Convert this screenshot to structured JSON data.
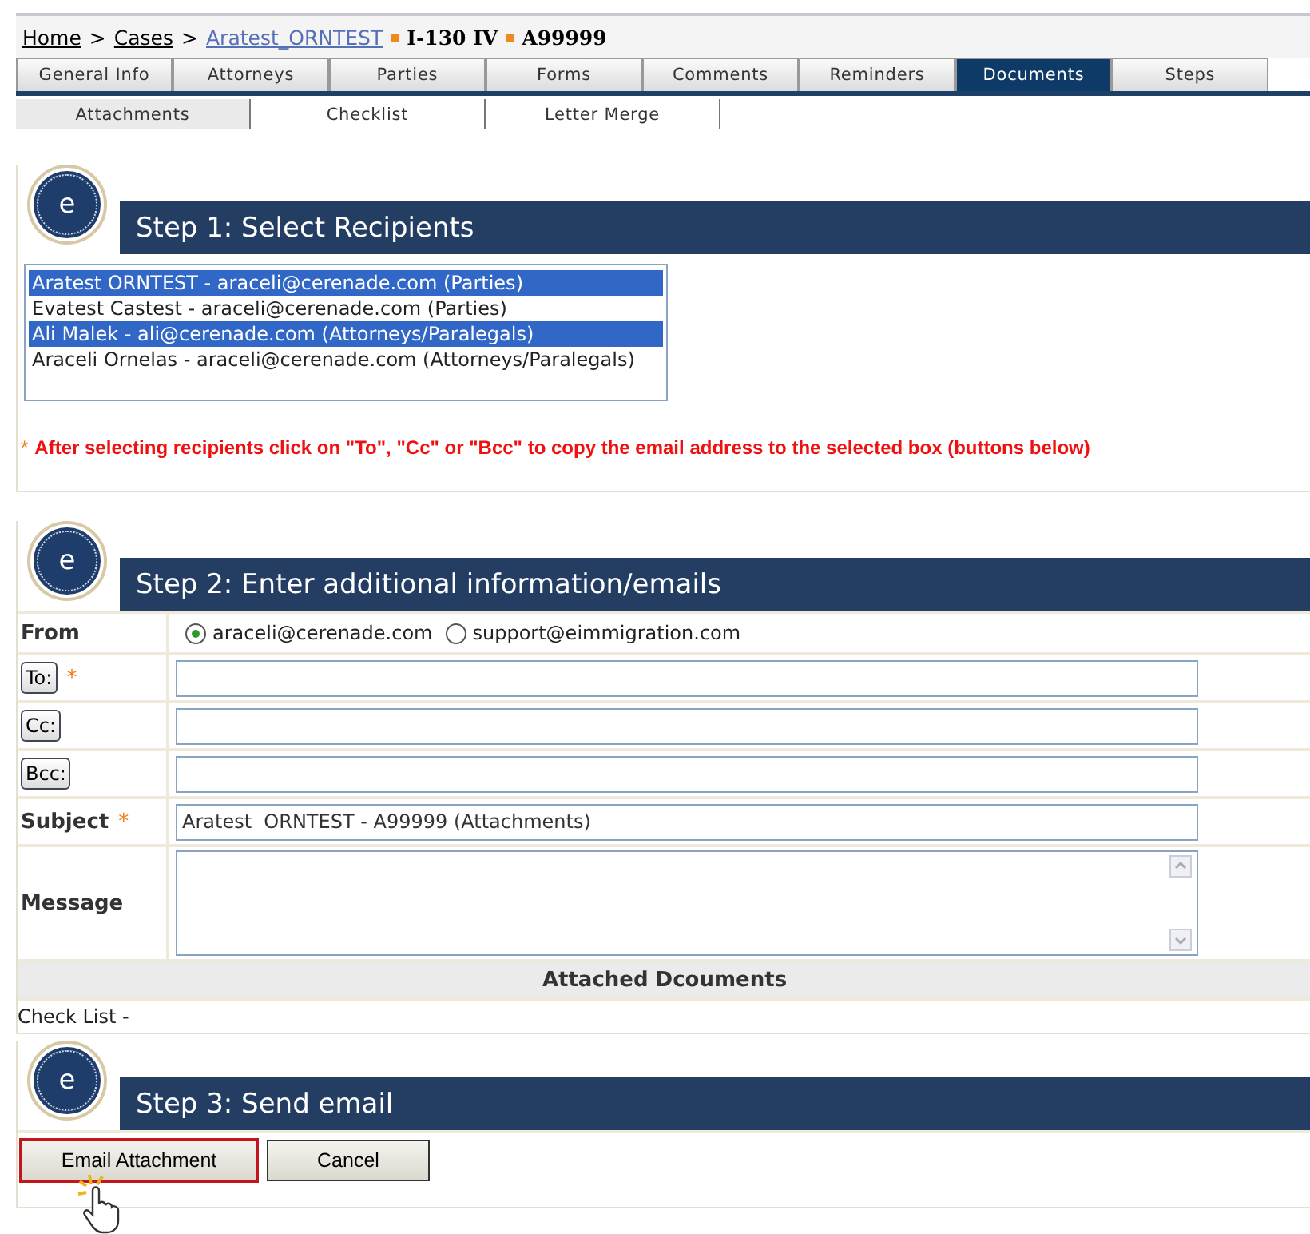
{
  "breadcrumb": [
    {
      "label": "Home",
      "kind": "link"
    },
    {
      "label": ">",
      "kind": "sep"
    },
    {
      "label": "Cases",
      "kind": "link"
    },
    {
      "label": ">",
      "kind": "sep"
    },
    {
      "label": "Aratest_ORNTEST",
      "kind": "case"
    },
    {
      "label": "I-130 IV",
      "kind": "bold"
    },
    {
      "label": "A99999",
      "kind": "bold"
    }
  ],
  "tabs": [
    {
      "label": "General Info",
      "selected": false
    },
    {
      "label": "Attorneys",
      "selected": false
    },
    {
      "label": "Parties",
      "selected": false
    },
    {
      "label": "Forms",
      "selected": false
    },
    {
      "label": "Comments",
      "selected": false
    },
    {
      "label": "Reminders",
      "selected": false
    },
    {
      "label": "Documents",
      "selected": true
    },
    {
      "label": "Steps",
      "selected": false
    }
  ],
  "subtabs": [
    {
      "label": "Attachments",
      "selected": true
    },
    {
      "label": "Checklist",
      "selected": false
    },
    {
      "label": "Letter Merge",
      "selected": false
    }
  ],
  "step1": {
    "badge": "e",
    "title": "Step 1: Select Recipients",
    "recipients": [
      {
        "label": "Aratest ORNTEST - araceli@cerenade.com (Parties)",
        "selected": true
      },
      {
        "label": "Evatest Castest - araceli@cerenade.com (Parties)",
        "selected": false
      },
      {
        "label": "Ali Malek - ali@cerenade.com (Attorneys/Paralegals)",
        "selected": true
      },
      {
        "label": "Araceli Ornelas - araceli@cerenade.com (Attorneys/Paralegals)",
        "selected": false
      }
    ],
    "note_mark": "*",
    "note": "After selecting recipients click on \"To\", \"Cc\" or \"Bcc\" to copy the email address to the selected box (buttons below)"
  },
  "step2": {
    "badge": "e",
    "title": "Step 2: Enter additional information/emails",
    "from": {
      "label": "From",
      "options": [
        {
          "label": "araceli@cerenade.com",
          "selected": true
        },
        {
          "label": "support@eimmigration.com",
          "selected": false
        }
      ]
    },
    "fields": [
      {
        "kind": "button",
        "label": "To:",
        "required": true
      },
      {
        "kind": "button",
        "label": "Cc:",
        "required": false
      },
      {
        "kind": "button",
        "label": "Bcc:",
        "required": false
      },
      {
        "kind": "label",
        "label": "Subject",
        "required": true,
        "value": "Aratest  ORNTEST - A99999 (Attachments)"
      },
      {
        "kind": "textarea",
        "label": "Message",
        "required": false
      }
    ],
    "required_mark": "*",
    "attached_heading": "Attached Dcouments",
    "checklist": "Check List -"
  },
  "step3": {
    "badge": "e",
    "title": "Step 3: Send email",
    "buttons": [
      {
        "label": "Email Attachment",
        "highlighted": true,
        "cursor": true
      },
      {
        "label": "Cancel",
        "highlighted": false,
        "cursor": false
      }
    ]
  }
}
